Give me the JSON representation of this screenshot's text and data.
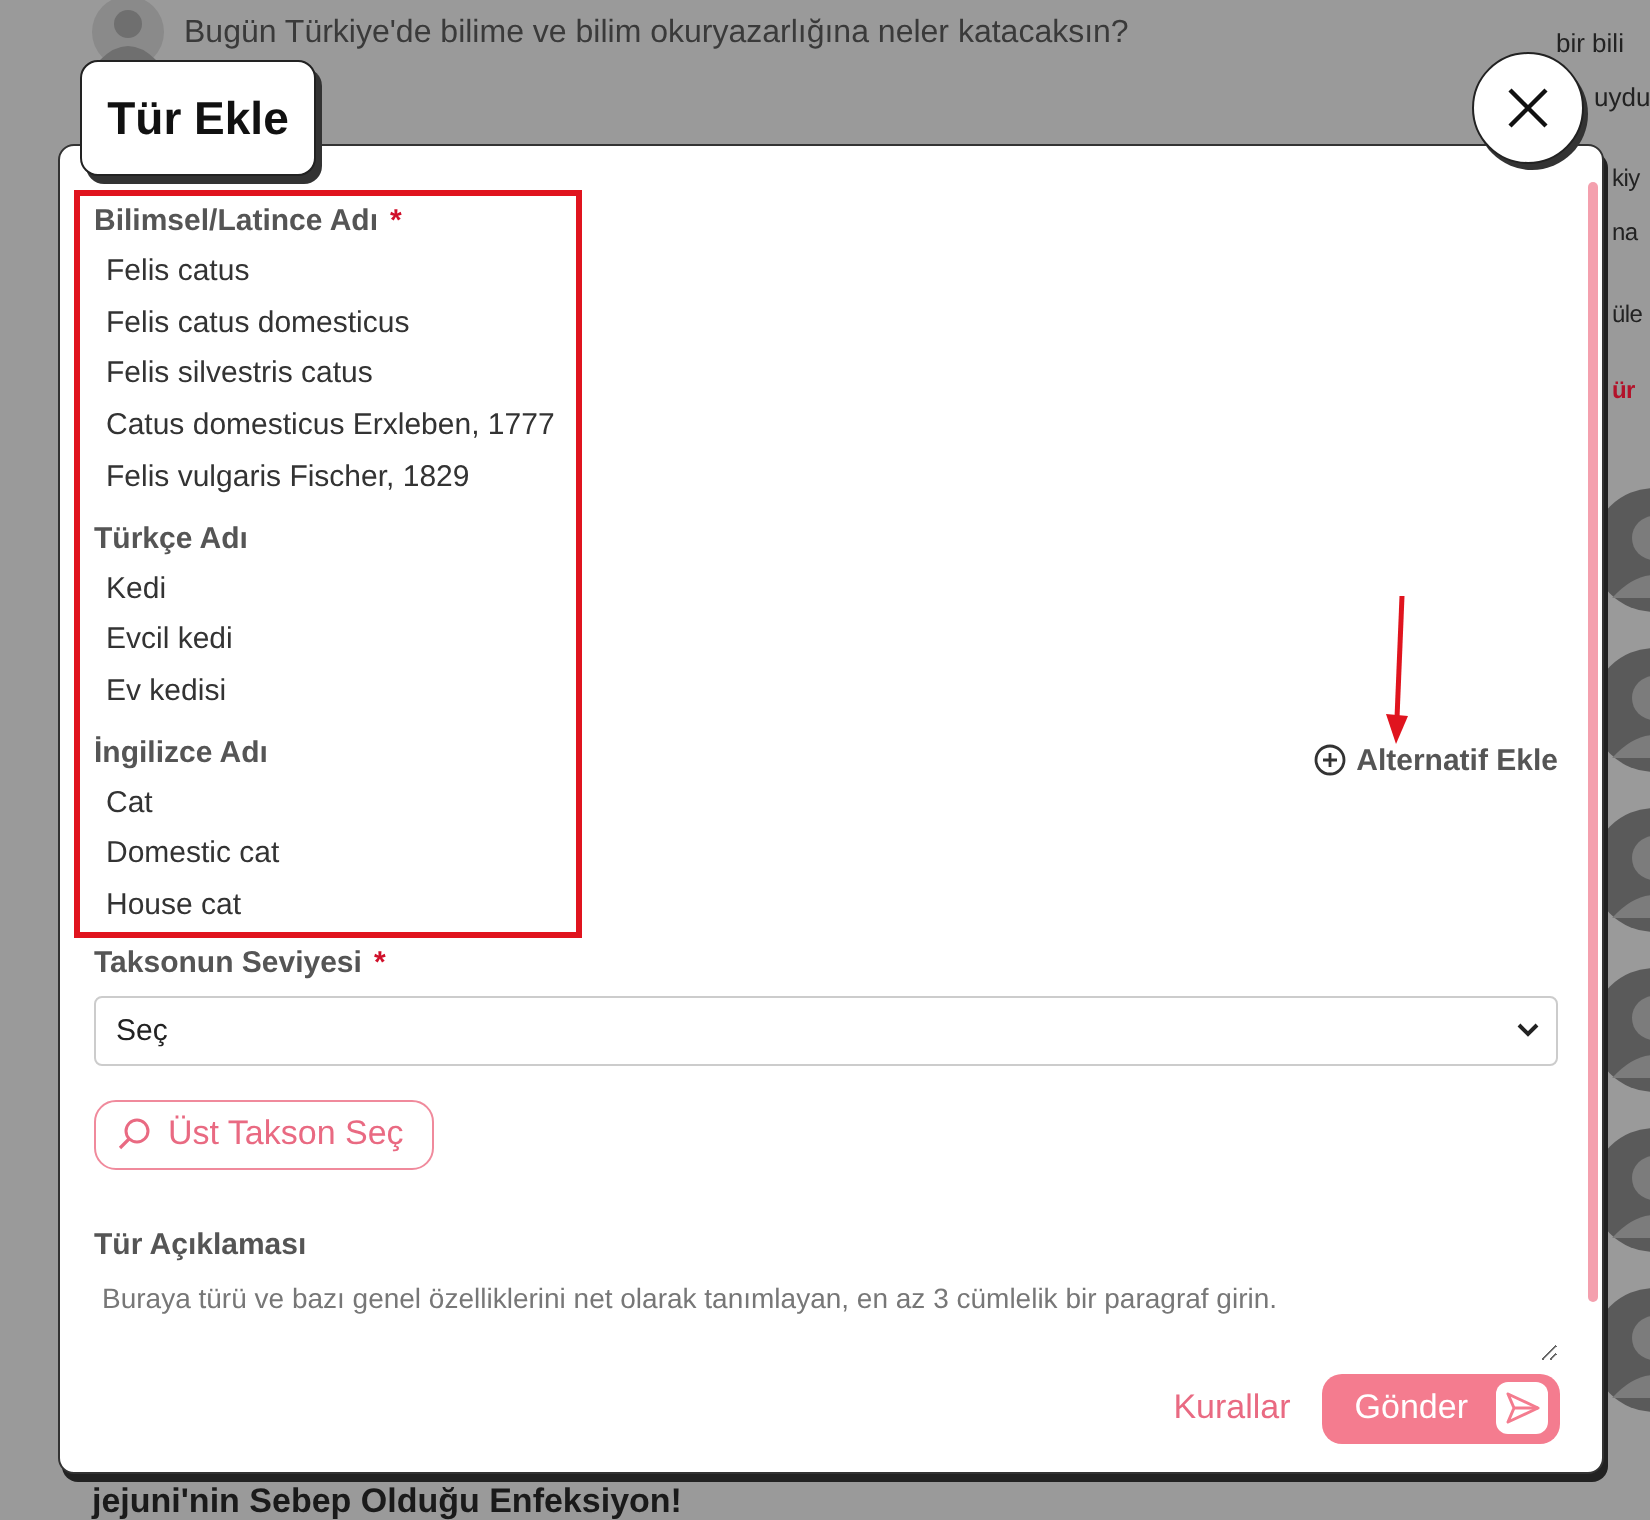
{
  "background": {
    "question": "Bugün Türkiye'de bilime ve bilim okuryazarlığına neler katacaksın?",
    "side_top": [
      "bir bili",
      "uydu"
    ],
    "side_lines": [
      "kiy",
      "na"
    ],
    "side_heading": "üle",
    "side_tag": "ür",
    "headline": "jejuni'nin Sebep Olduğu Enfeksiyon!"
  },
  "dialog": {
    "title": "Tür Ekle",
    "name_groups": [
      {
        "label": "Bilimsel/Latince Adı",
        "required_mark": "*",
        "names": [
          "Felis catus",
          "Felis catus domesticus",
          "Felis silvestris catus",
          "Catus domesticus Erxleben, 1777",
          "Felis vulgaris Fischer, 1829"
        ]
      },
      {
        "label": "Türkçe Adı",
        "names": [
          "Kedi",
          "Evcil kedi",
          "Ev kedisi"
        ]
      },
      {
        "label": "İngilizce Adı",
        "names": [
          "Cat",
          "Domestic cat",
          "House cat"
        ]
      }
    ],
    "add_alternative": "Alternatif Ekle",
    "level_field": {
      "label": "Taksonun Seviyesi",
      "required_mark": "*",
      "value": "Seç"
    },
    "parent_button": "Üst Takson Seç",
    "description": {
      "label": "Tür Açıklaması",
      "placeholder": "Buraya türü ve bazı genel özelliklerini net olarak tanımlayan, en az 3 cümlelik bir paragraf girin."
    },
    "rules_link": "Kurallar",
    "submit": "Gönder"
  }
}
